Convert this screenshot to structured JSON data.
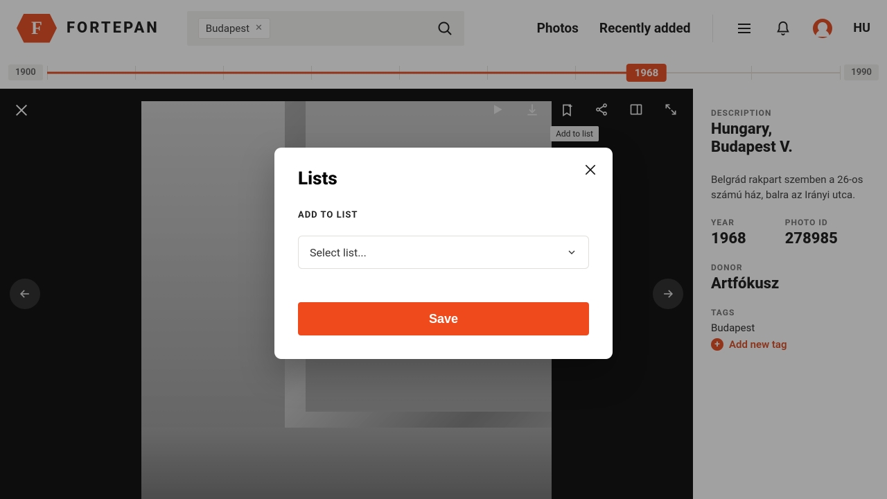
{
  "brand": {
    "letter": "F",
    "name": "FORTEPAN"
  },
  "search": {
    "chip": "Budapest"
  },
  "nav": {
    "photos": "Photos",
    "recent": "Recently added",
    "lang": "HU"
  },
  "timeline": {
    "start": "1900",
    "end": "1990",
    "current": "1968",
    "fill_pct": 75.6
  },
  "toolbar": {
    "tooltip": "Add to list"
  },
  "sidebar": {
    "desc_label": "DESCRIPTION",
    "title_line1": "Hungary,",
    "title_line2": "Budapest V.",
    "desc": "Belgrád rakpart szemben a 26-os számú ház, balra az Irányi utca.",
    "year_label": "YEAR",
    "year": "1968",
    "photoid_label": "PHOTO ID",
    "photoid": "278985",
    "donor_label": "DONOR",
    "donor": "Artfókusz",
    "tags_label": "TAGS",
    "tag0": "Budapest",
    "add_tag": "Add new tag"
  },
  "modal": {
    "title": "Lists",
    "section_label": "ADD TO LIST",
    "select_placeholder": "Select list...",
    "save": "Save"
  }
}
